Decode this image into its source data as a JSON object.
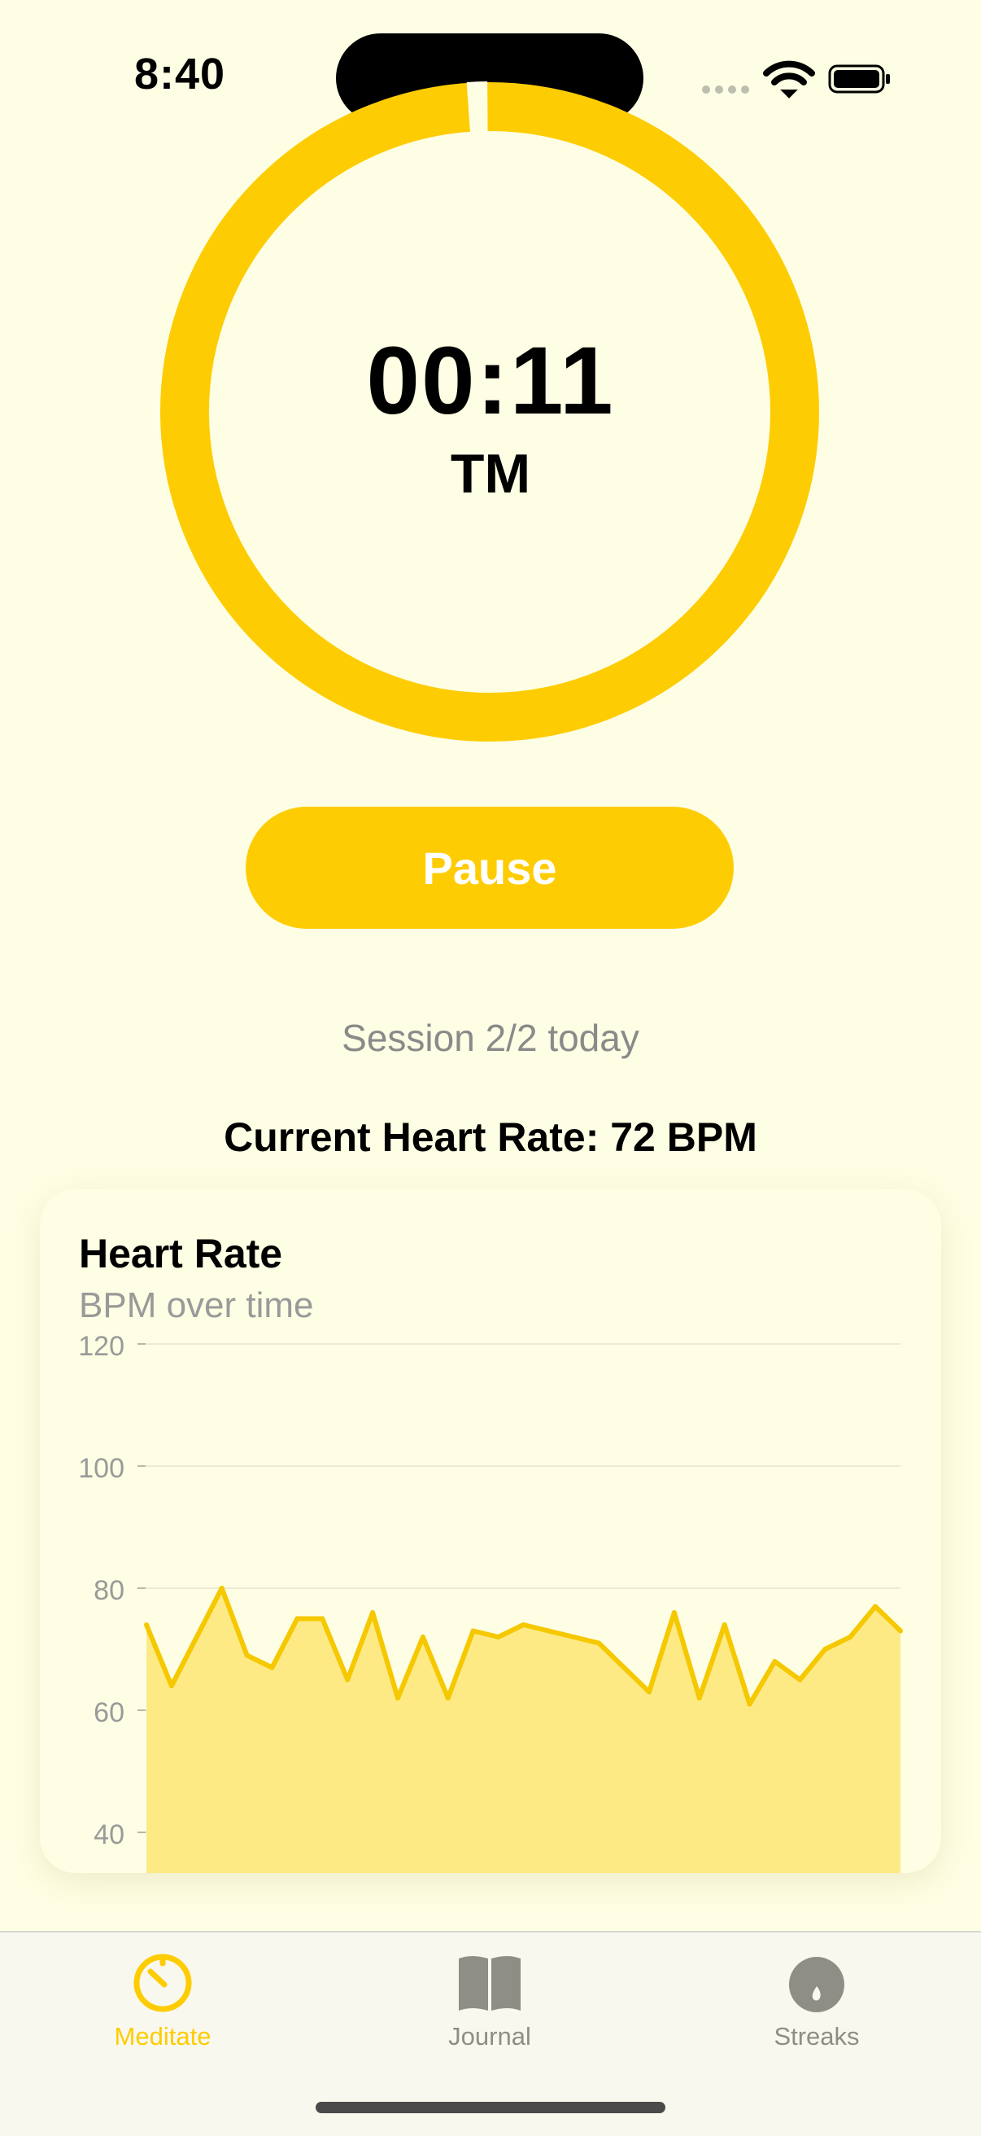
{
  "status_bar": {
    "time": "8:40"
  },
  "timer": {
    "elapsed": "00:11",
    "label": "TM",
    "progress": 0.99,
    "ring_color": "#fecc02"
  },
  "controls": {
    "pause_label": "Pause"
  },
  "session": {
    "text": "Session 2/2 today"
  },
  "heart_rate": {
    "current_text": "Current Heart Rate: 72 BPM"
  },
  "chart_card": {
    "title": "Heart Rate",
    "subtitle": "BPM over time"
  },
  "chart_data": {
    "type": "area",
    "title": "Heart Rate",
    "subtitle": "BPM over time",
    "xlabel": "",
    "ylabel": "",
    "ylim": [
      35,
      120
    ],
    "y_ticks": [
      120,
      100,
      80,
      60,
      40
    ],
    "grid": true,
    "color": "#f5c800",
    "fill_color": "#fde97f",
    "series": [
      {
        "values": [
          74,
          64,
          72,
          80,
          69,
          67,
          75,
          75,
          65,
          76,
          62,
          72,
          62,
          73,
          72,
          74,
          73,
          72,
          71,
          67,
          63,
          76,
          62,
          74,
          61,
          68,
          65,
          70,
          72,
          77,
          73
        ]
      }
    ]
  },
  "tabs": [
    {
      "label": "Meditate",
      "icon": "timer-icon",
      "active": true
    },
    {
      "label": "Journal",
      "icon": "book-icon",
      "active": false
    },
    {
      "label": "Streaks",
      "icon": "flame-icon",
      "active": false
    }
  ],
  "colors": {
    "accent": "#fecc02",
    "background": "#fefee4",
    "inactive": "#8e8e86"
  }
}
